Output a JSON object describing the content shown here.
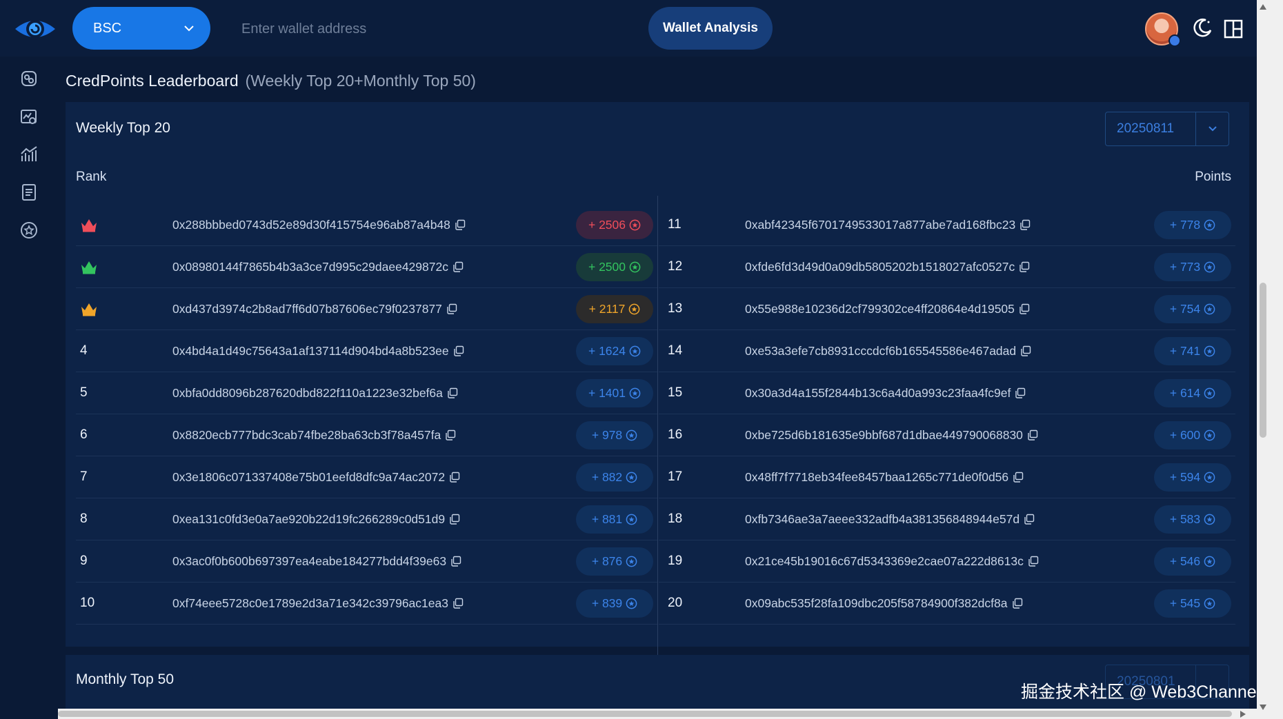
{
  "header": {
    "chain": "BSC",
    "address_placeholder": "Enter wallet address",
    "analysis_button": "Wallet Analysis"
  },
  "sidebar": {
    "items": [
      {
        "icon": "brain-icon"
      },
      {
        "icon": "chart-search-icon"
      },
      {
        "icon": "trend-chart-icon"
      },
      {
        "icon": "clipboard-icon"
      },
      {
        "icon": "star-circle-icon"
      }
    ]
  },
  "leaderboard": {
    "title": "CredPoints Leaderboard",
    "subtitle": "(Weekly Top 20+Monthly Top 50)",
    "weekly": {
      "title": "Weekly Top 20",
      "date": "20250811",
      "rank_header": "Rank",
      "points_header": "Points",
      "rows": [
        {
          "rank": "1",
          "crown": "red",
          "address": "0x288bbbed0743d52e89d30f415754e96ab87a4b48",
          "points": "+ 2506"
        },
        {
          "rank": "2",
          "crown": "green",
          "address": "0x08980144f7865b4b3a3ce7d995c29daee429872c",
          "points": "+ 2500"
        },
        {
          "rank": "3",
          "crown": "gold",
          "address": "0xd437d3974c2b8ad7ff6d07b87606ec79f0237877",
          "points": "+ 2117"
        },
        {
          "rank": "4",
          "address": "0x4bd4a1d49c75643a1af137114d904bd4a8b523ee",
          "points": "+ 1624"
        },
        {
          "rank": "5",
          "address": "0xbfa0dd8096b287620dbd822f110a1223e32bef6a",
          "points": "+ 1401"
        },
        {
          "rank": "6",
          "address": "0x8820ecb777bdc3cab74fbe28ba63cb3f78a457fa",
          "points": "+ 978"
        },
        {
          "rank": "7",
          "address": "0x3e1806c071337408e75b01eefd8dfc9a74ac2072",
          "points": "+ 882"
        },
        {
          "rank": "8",
          "address": "0xea131c0fd3e0a7ae920b22d19fc266289c0d51d9",
          "points": "+ 881"
        },
        {
          "rank": "9",
          "address": "0x3ac0f0b600b697397ea4eabe184277bdd4f39e63",
          "points": "+ 876"
        },
        {
          "rank": "10",
          "address": "0xf74eee5728c0e1789e2d3a71e342c39796ac1ea3",
          "points": "+ 839"
        },
        {
          "rank": "11",
          "address": "0xabf42345f6701749533017a877abe7ad168fbc23",
          "points": "+ 778"
        },
        {
          "rank": "12",
          "address": "0xfde6fd3d49d0a09db5805202b1518027afc0527c",
          "points": "+ 773"
        },
        {
          "rank": "13",
          "address": "0x55e988e10236d2cf799302ce4ff20864e4d19505",
          "points": "+ 754"
        },
        {
          "rank": "14",
          "address": "0xe53a3efe7cb8931cccdcf6b165545586e467adad",
          "points": "+ 741"
        },
        {
          "rank": "15",
          "address": "0x30a3d4a155f2844b13c6a4d0a993c23faa4fc9ef",
          "points": "+ 614"
        },
        {
          "rank": "16",
          "address": "0xbe725d6b181635e9bbf687d1dbae449790068830",
          "points": "+ 600"
        },
        {
          "rank": "17",
          "address": "0x48ff7f7718eb34fee8457baa1265c771de0f0d56",
          "points": "+ 594"
        },
        {
          "rank": "18",
          "address": "0xfb7346ae3a7aeee332adfb4a381356848944e57d",
          "points": "+ 583"
        },
        {
          "rank": "19",
          "address": "0x21ce45b19016c67d5343369e2cae07a222d8613c",
          "points": "+ 546"
        },
        {
          "rank": "20",
          "address": "0x09abc535f28fa109dbc205f58784900f382dcf8a",
          "points": "+ 545"
        }
      ]
    },
    "monthly": {
      "title": "Monthly Top 50",
      "date": "20250801"
    }
  },
  "watermark": "掘金技术社区 @ Web3Channel",
  "colors": {
    "accent": "#1877e6",
    "crown_red": "#f04e5a",
    "crown_green": "#33c45f",
    "crown_gold": "#f0a52a"
  }
}
